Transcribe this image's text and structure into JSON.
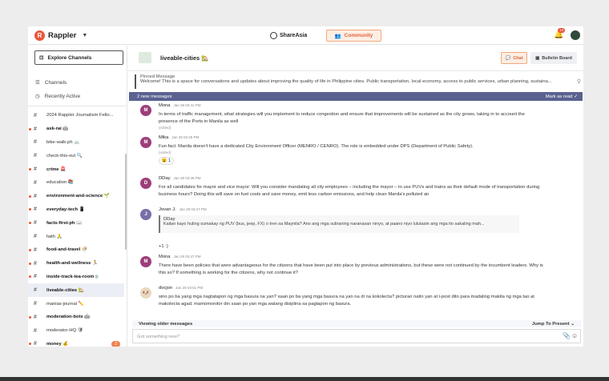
{
  "header": {
    "brand": "Rappler",
    "shareasia": "ShareAsia",
    "community": "Community",
    "notifications": "14"
  },
  "sidebar": {
    "explore": "Explore Channels",
    "nav": [
      "Channels",
      "Recently Active"
    ],
    "channels": [
      {
        "name": "2024 Rappler Journalism Fello...",
        "bold": false,
        "dot": false
      },
      {
        "name": "ask-rai 🤖",
        "bold": true,
        "dot": true
      },
      {
        "name": "bike-walk-ph 🚲",
        "bold": false,
        "dot": false
      },
      {
        "name": "check-this-out 🔍",
        "bold": false,
        "dot": false
      },
      {
        "name": "crime 🚨",
        "bold": true,
        "dot": true
      },
      {
        "name": "education 📚",
        "bold": false,
        "dot": false
      },
      {
        "name": "environment-and-science 🌱",
        "bold": true,
        "dot": true
      },
      {
        "name": "everyday-tech 📱",
        "bold": true,
        "dot": true
      },
      {
        "name": "facts-first-ph 📖",
        "bold": true,
        "dot": true
      },
      {
        "name": "faith 🙏",
        "bold": false,
        "dot": false
      },
      {
        "name": "food-and-travel 🍜",
        "bold": true,
        "dot": true
      },
      {
        "name": "health-and-wellness 🏃",
        "bold": true,
        "dot": true
      },
      {
        "name": "inside-track-tea-room🍵",
        "bold": true,
        "dot": true
      },
      {
        "name": "liveable-cities 🏡",
        "bold": true,
        "dot": false,
        "active": true
      },
      {
        "name": "manias-journal ✏️",
        "bold": false,
        "dot": false
      },
      {
        "name": "moderation-bots 🤖",
        "bold": true,
        "dot": true
      },
      {
        "name": "moderator-HQ 🛡",
        "bold": false,
        "dot": false
      },
      {
        "name": "money 💰",
        "bold": true,
        "dot": true,
        "count": "2"
      }
    ]
  },
  "channel": {
    "name": "liveable-cities 🏡",
    "chat": "Chat",
    "bulletin": "Bulletin Board"
  },
  "pinned": {
    "title": "Pinned Message",
    "text": "Welcome! This is a space for conversations and updates about improving the quality of life in Philippine cities. Public transportation, local economy, access to public services, urban planning, sustaina..."
  },
  "newbar": {
    "label": "2 new messages",
    "mark": "Mark as read ✓"
  },
  "messages": [
    {
      "initial": "M",
      "author": "Mona",
      "time": "Jan 29 03:41 PM",
      "text": "In terms of traffic management, what strategies will you implement to reduce congestion and ensure that improvements will be sustained as the city grows, taking in to account the presence of the Ports in Manila as well",
      "edited": "(edited)"
    },
    {
      "initial": "M",
      "author": "Mika",
      "time": "Jan 29 03:45 PM",
      "text": "Fun fact: Manila doesn't have a dedicated City Environment Officer (MENRO / CENRO). The role is embedded under DPS (Department of Public Safety).",
      "edited": "(edited)",
      "reaction": "😮 1"
    },
    {
      "initial": "D",
      "author": "DDay",
      "time": "Jan 29 03:46 PM",
      "text": "For all candidates for mayor and vice mayor: Will you consider mandating all city employees – including the mayor – to use PUVs and trains as their default mode of transportation during business hours? Doing this will save on fuel costs and save money, emit less carbon emissions, and help clean Manila's polluted air"
    },
    {
      "initial": "J",
      "author": "Jovan J.",
      "time": "Jan 29 03:47 PM",
      "quote_author": "DDay",
      "quote_text": "Kailan kayo huling sumakay ng PUV (bus, jeep, FX) o tren sa Maynila? Ano ang mga suliraning naranasan ninyo, at paano niyo lulutasin ang mga ito sakaling mah...",
      "text": "+1 :)"
    },
    {
      "initial": "M",
      "author": "Mona",
      "time": "Jan 29 03:47 PM",
      "text": "There have been policies that were advantageous for the citizens that have been put into place by previous administrations, but these were not continued by the incumbent leaders. Why is this so? If something is working for the citizens, why not continue it?"
    },
    {
      "initial": "🐶",
      "author": "docjon",
      "time": "Jan 29 03:51 PM",
      "text": "sino po ba yang mga nagtatapon ng mga basura na yan? saan po ba yang mga basura na yan na di na kokolecta? picturan natin yan at i-post dito para madaling makita ng mga tao at makolecta agad. mamomonitor din saan po yan mga walang disiplina sa pagtapon ng basura."
    }
  ],
  "footer": {
    "older": "Viewing older messages",
    "jump": "Jump To Present ⌄",
    "placeholder": "Got something new?"
  }
}
